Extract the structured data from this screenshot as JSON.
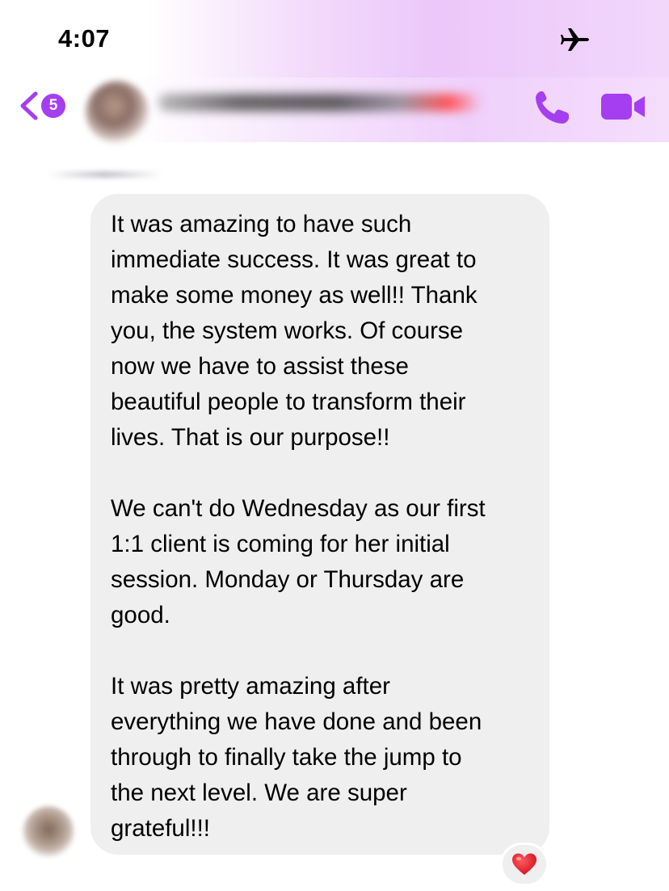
{
  "status_bar": {
    "time": "4:07",
    "airplane_icon": "airplane-icon"
  },
  "header": {
    "back_icon": "chevron-left-icon",
    "unread_badge": "5",
    "phone_icon": "phone-icon",
    "video_icon": "video-camera-icon",
    "accent_color": "#a53ef0"
  },
  "message": {
    "paragraphs": [
      "It was amazing to have such\nimmediate success. It was great to\nmake some money as well!! Thank\nyou, the system works. Of course\nnow we have to assist these\nbeautiful people to transform their\nlives. That is our purpose!!",
      "We can't do Wednesday as our first\n1:1 client is coming for her initial\nsession. Monday or Thursday are\ngood.",
      "It was pretty amazing after\neverything we have done and been\nthrough to finally take the jump to\nthe next level. We are super\ngrateful!!!"
    ],
    "bubble_color": "#efeff0",
    "reaction": "❤️",
    "reaction_color": "#e8232f"
  }
}
